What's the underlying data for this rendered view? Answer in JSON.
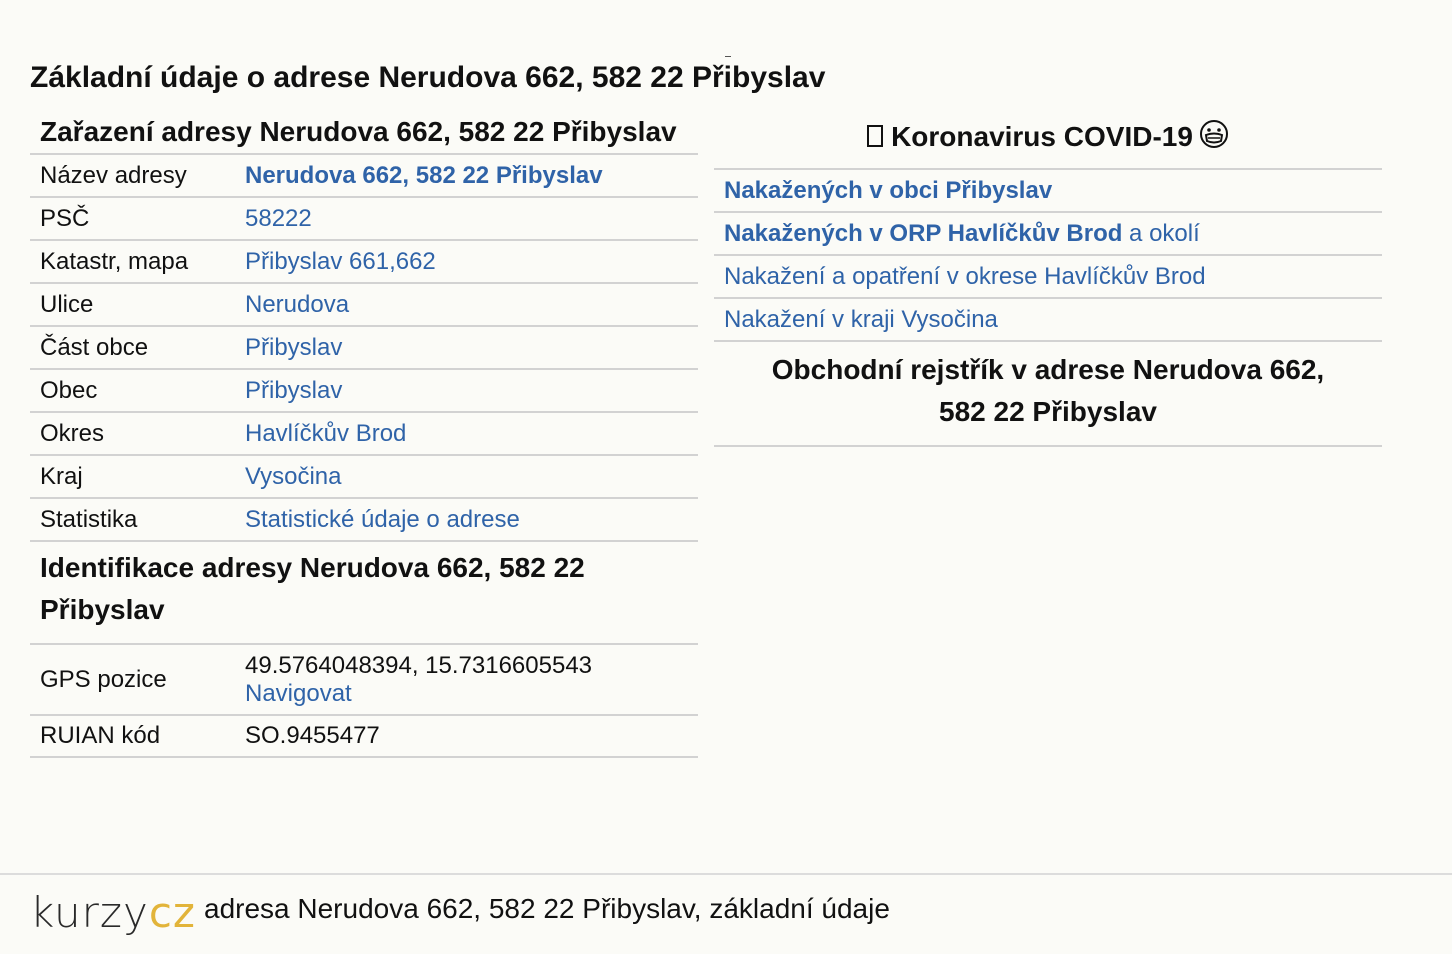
{
  "page": {
    "title": "Základní údaje o adrese Nerudova 662, 582 22 Přibyslav"
  },
  "classification": {
    "heading": "Zařazení adresy Nerudova 662, 582 22 Přibyslav",
    "rows": [
      {
        "label": "Název adresy",
        "value": "Nerudova 662, 582 22 Přibyslav"
      },
      {
        "label": "PSČ",
        "value": "58222"
      },
      {
        "label": "Katastr, mapa",
        "value": "Přibyslav 661,662"
      },
      {
        "label": "Ulice",
        "value": "Nerudova"
      },
      {
        "label": "Část obce",
        "value": "Přibyslav"
      },
      {
        "label": "Obec",
        "value": "Přibyslav"
      },
      {
        "label": "Okres",
        "value": "Havlíčkův Brod"
      },
      {
        "label": "Kraj",
        "value": "Vysočina"
      },
      {
        "label": "Statistika",
        "value": "Statistické údaje o adrese"
      }
    ]
  },
  "identification": {
    "heading": "Identifikace adresy Nerudova 662, 582 22 Přibyslav",
    "gps_label": "GPS pozice",
    "gps_value": "49.5764048394, 15.7316605543",
    "navigate": "Navigovat",
    "ruian_label": "RUIAN kód",
    "ruian_value": "SO.9455477"
  },
  "covid": {
    "heading": "Koronavirus COVID-19",
    "icon_left": "missing-glyph-box",
    "icon_right": "face-with-mask-icon",
    "links": [
      {
        "strong": "Nakažených v obci Přibyslav",
        "suffix": ""
      },
      {
        "strong": "Nakažených v ORP Havlíčkův Brod",
        "suffix": " a okolí"
      },
      {
        "strong": "",
        "suffix": "Nakažení a opatření v okrese Havlíčkův Brod"
      },
      {
        "strong": "",
        "suffix": "Nakažení v kraji Vysočina"
      }
    ]
  },
  "register": {
    "heading_line1": "Obchodní rejstřík v adrese Nerudova 662,",
    "heading_line2": "582 22 Přibyslav"
  },
  "footer": {
    "logo_part1": "KURZY",
    "logo_part2": "CZ",
    "text": "adresa Nerudova 662, 582 22 Přibyslav, základní údaje"
  },
  "colors": {
    "link": "#2f63a8",
    "logo_accent": "#e2b43a",
    "divider": "#d2d2d2",
    "background": "#fbfbf7"
  }
}
